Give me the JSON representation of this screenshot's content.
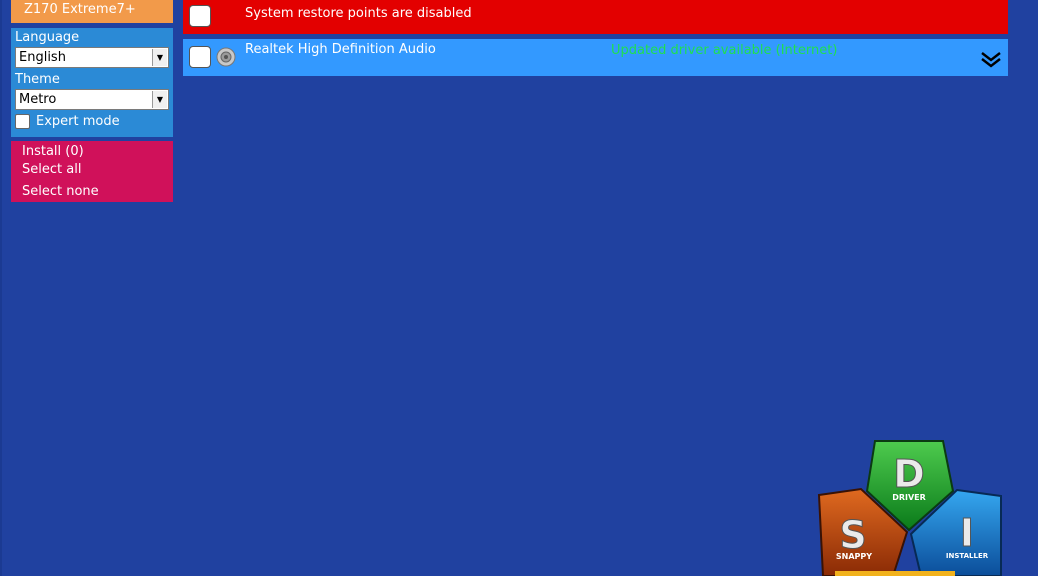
{
  "sidebar": {
    "device_name": "Z170 Extreme7+",
    "language_label": "Language",
    "language_value": "English",
    "theme_label": "Theme",
    "theme_value": "Metro",
    "expert_mode_label": "Expert mode",
    "install_label": "Install (0)",
    "select_all_label": "Select all",
    "select_none_label": "Select none"
  },
  "drivers": {
    "restore_warning": "System restore points are disabled",
    "items": [
      {
        "name": "Realtek High Definition Audio",
        "status": "Updated driver available (Internet)"
      }
    ]
  },
  "logo": {
    "letters": [
      "D",
      "S",
      "I"
    ],
    "words": [
      "DRIVER",
      "SNAPPY",
      "INSTALLER"
    ]
  },
  "colors": {
    "background": "#2041a0",
    "device_panel": "#f29a4a",
    "settings_panel": "#2b8ad6",
    "actions_panel": "#d0115a",
    "warning_row": "#e30000",
    "driver_row": "#3399ff",
    "status_text": "#1fe050"
  }
}
